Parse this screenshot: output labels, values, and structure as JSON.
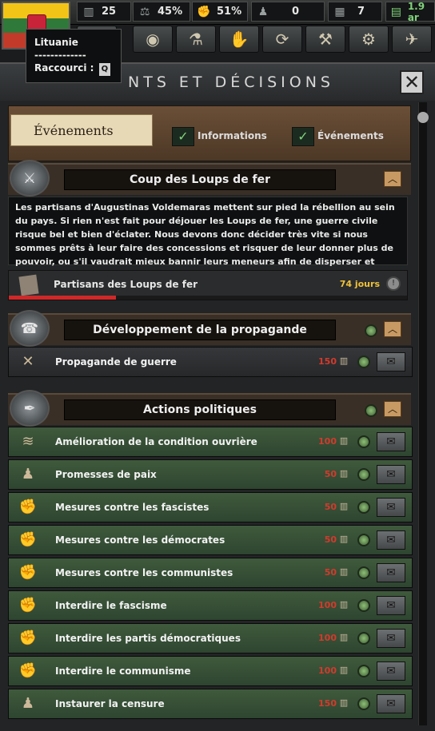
{
  "topbar": {
    "stats": [
      {
        "icon": "factory-icon",
        "value": "25"
      },
      {
        "icon": "scales-icon",
        "value": "45%"
      },
      {
        "icon": "muscle-arm-icon",
        "value": "51%"
      },
      {
        "icon": "manpower-icon",
        "value": "0"
      },
      {
        "icon": "civilian-factory-icon",
        "value": "7"
      },
      {
        "icon": "money-icon",
        "value": "1.9 ar"
      }
    ]
  },
  "tooltip": {
    "country": "Lituanie",
    "separator": "-------------",
    "shortcut_label": "Raccourci :",
    "shortcut_key": "Q"
  },
  "panel": {
    "title": "NTS ET DÉCISIONS",
    "close_label": "✕"
  },
  "tabs": {
    "active": "Événements",
    "filters": [
      {
        "label": "Informations",
        "checked": true
      },
      {
        "label": "Événements",
        "checked": true
      }
    ]
  },
  "sections": {
    "iron_wolf": {
      "title": "Coup des Loups de fer",
      "description": "Les partisans d'Augustinas Voldemaras mettent sur pied la rébellion au sein du pays. Si rien n'est fait pour déjouer les Loups de fer, une guerre civile risque bel et bien d'éclater. Nous devons donc décider très vite si nous sommes prêts à leur faire des concessions et risquer de leur donner plus de pouvoir, ou s'il vaudrait mieux bannir leurs meneurs afin de disperser et désorganiser les militants.",
      "mission": {
        "label": "Partisans des Loups de fer",
        "days": "74 jours",
        "progress": 0.27
      }
    },
    "propaganda": {
      "title": "Développement de la propagande",
      "decisions": [
        {
          "label": "Propagande de guerre",
          "cost": "150",
          "icon": "crossed-swords-icon"
        }
      ]
    },
    "political": {
      "title": "Actions politiques",
      "decisions": [
        {
          "label": "Amélioration de la condition ouvrière",
          "cost": "100",
          "icon": "workers-icon"
        },
        {
          "label": "Promesses de paix",
          "cost": "50",
          "icon": "people-icon"
        },
        {
          "label": "Mesures contre les fascistes",
          "cost": "50",
          "icon": "fist-icon"
        },
        {
          "label": "Mesures contre les démocrates",
          "cost": "50",
          "icon": "fist-icon"
        },
        {
          "label": "Mesures contre les communistes",
          "cost": "50",
          "icon": "fist-icon"
        },
        {
          "label": "Interdire le fascisme",
          "cost": "100",
          "icon": "fist-icon"
        },
        {
          "label": "Interdire les partis démocratiques",
          "cost": "100",
          "icon": "fist-icon"
        },
        {
          "label": "Interdire le communisme",
          "cost": "100",
          "icon": "fist-icon"
        },
        {
          "label": "Instaurer la censure",
          "cost": "150",
          "icon": "people-icon"
        }
      ]
    }
  }
}
